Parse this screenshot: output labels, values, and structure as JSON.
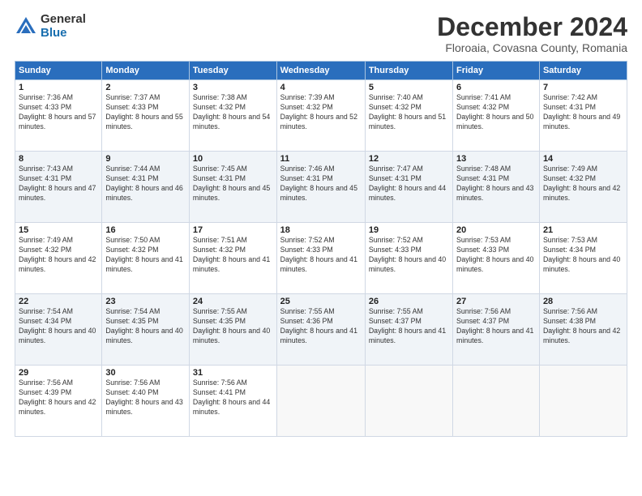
{
  "header": {
    "logo_general": "General",
    "logo_blue": "Blue",
    "month_title": "December 2024",
    "location": "Floroaia, Covasna County, Romania"
  },
  "days_of_week": [
    "Sunday",
    "Monday",
    "Tuesday",
    "Wednesday",
    "Thursday",
    "Friday",
    "Saturday"
  ],
  "weeks": [
    [
      {
        "day": "1",
        "sunrise": "Sunrise: 7:36 AM",
        "sunset": "Sunset: 4:33 PM",
        "daylight": "Daylight: 8 hours and 57 minutes."
      },
      {
        "day": "2",
        "sunrise": "Sunrise: 7:37 AM",
        "sunset": "Sunset: 4:33 PM",
        "daylight": "Daylight: 8 hours and 55 minutes."
      },
      {
        "day": "3",
        "sunrise": "Sunrise: 7:38 AM",
        "sunset": "Sunset: 4:32 PM",
        "daylight": "Daylight: 8 hours and 54 minutes."
      },
      {
        "day": "4",
        "sunrise": "Sunrise: 7:39 AM",
        "sunset": "Sunset: 4:32 PM",
        "daylight": "Daylight: 8 hours and 52 minutes."
      },
      {
        "day": "5",
        "sunrise": "Sunrise: 7:40 AM",
        "sunset": "Sunset: 4:32 PM",
        "daylight": "Daylight: 8 hours and 51 minutes."
      },
      {
        "day": "6",
        "sunrise": "Sunrise: 7:41 AM",
        "sunset": "Sunset: 4:32 PM",
        "daylight": "Daylight: 8 hours and 50 minutes."
      },
      {
        "day": "7",
        "sunrise": "Sunrise: 7:42 AM",
        "sunset": "Sunset: 4:31 PM",
        "daylight": "Daylight: 8 hours and 49 minutes."
      }
    ],
    [
      {
        "day": "8",
        "sunrise": "Sunrise: 7:43 AM",
        "sunset": "Sunset: 4:31 PM",
        "daylight": "Daylight: 8 hours and 47 minutes."
      },
      {
        "day": "9",
        "sunrise": "Sunrise: 7:44 AM",
        "sunset": "Sunset: 4:31 PM",
        "daylight": "Daylight: 8 hours and 46 minutes."
      },
      {
        "day": "10",
        "sunrise": "Sunrise: 7:45 AM",
        "sunset": "Sunset: 4:31 PM",
        "daylight": "Daylight: 8 hours and 45 minutes."
      },
      {
        "day": "11",
        "sunrise": "Sunrise: 7:46 AM",
        "sunset": "Sunset: 4:31 PM",
        "daylight": "Daylight: 8 hours and 45 minutes."
      },
      {
        "day": "12",
        "sunrise": "Sunrise: 7:47 AM",
        "sunset": "Sunset: 4:31 PM",
        "daylight": "Daylight: 8 hours and 44 minutes."
      },
      {
        "day": "13",
        "sunrise": "Sunrise: 7:48 AM",
        "sunset": "Sunset: 4:31 PM",
        "daylight": "Daylight: 8 hours and 43 minutes."
      },
      {
        "day": "14",
        "sunrise": "Sunrise: 7:49 AM",
        "sunset": "Sunset: 4:32 PM",
        "daylight": "Daylight: 8 hours and 42 minutes."
      }
    ],
    [
      {
        "day": "15",
        "sunrise": "Sunrise: 7:49 AM",
        "sunset": "Sunset: 4:32 PM",
        "daylight": "Daylight: 8 hours and 42 minutes."
      },
      {
        "day": "16",
        "sunrise": "Sunrise: 7:50 AM",
        "sunset": "Sunset: 4:32 PM",
        "daylight": "Daylight: 8 hours and 41 minutes."
      },
      {
        "day": "17",
        "sunrise": "Sunrise: 7:51 AM",
        "sunset": "Sunset: 4:32 PM",
        "daylight": "Daylight: 8 hours and 41 minutes."
      },
      {
        "day": "18",
        "sunrise": "Sunrise: 7:52 AM",
        "sunset": "Sunset: 4:33 PM",
        "daylight": "Daylight: 8 hours and 41 minutes."
      },
      {
        "day": "19",
        "sunrise": "Sunrise: 7:52 AM",
        "sunset": "Sunset: 4:33 PM",
        "daylight": "Daylight: 8 hours and 40 minutes."
      },
      {
        "day": "20",
        "sunrise": "Sunrise: 7:53 AM",
        "sunset": "Sunset: 4:33 PM",
        "daylight": "Daylight: 8 hours and 40 minutes."
      },
      {
        "day": "21",
        "sunrise": "Sunrise: 7:53 AM",
        "sunset": "Sunset: 4:34 PM",
        "daylight": "Daylight: 8 hours and 40 minutes."
      }
    ],
    [
      {
        "day": "22",
        "sunrise": "Sunrise: 7:54 AM",
        "sunset": "Sunset: 4:34 PM",
        "daylight": "Daylight: 8 hours and 40 minutes."
      },
      {
        "day": "23",
        "sunrise": "Sunrise: 7:54 AM",
        "sunset": "Sunset: 4:35 PM",
        "daylight": "Daylight: 8 hours and 40 minutes."
      },
      {
        "day": "24",
        "sunrise": "Sunrise: 7:55 AM",
        "sunset": "Sunset: 4:35 PM",
        "daylight": "Daylight: 8 hours and 40 minutes."
      },
      {
        "day": "25",
        "sunrise": "Sunrise: 7:55 AM",
        "sunset": "Sunset: 4:36 PM",
        "daylight": "Daylight: 8 hours and 41 minutes."
      },
      {
        "day": "26",
        "sunrise": "Sunrise: 7:55 AM",
        "sunset": "Sunset: 4:37 PM",
        "daylight": "Daylight: 8 hours and 41 minutes."
      },
      {
        "day": "27",
        "sunrise": "Sunrise: 7:56 AM",
        "sunset": "Sunset: 4:37 PM",
        "daylight": "Daylight: 8 hours and 41 minutes."
      },
      {
        "day": "28",
        "sunrise": "Sunrise: 7:56 AM",
        "sunset": "Sunset: 4:38 PM",
        "daylight": "Daylight: 8 hours and 42 minutes."
      }
    ],
    [
      {
        "day": "29",
        "sunrise": "Sunrise: 7:56 AM",
        "sunset": "Sunset: 4:39 PM",
        "daylight": "Daylight: 8 hours and 42 minutes."
      },
      {
        "day": "30",
        "sunrise": "Sunrise: 7:56 AM",
        "sunset": "Sunset: 4:40 PM",
        "daylight": "Daylight: 8 hours and 43 minutes."
      },
      {
        "day": "31",
        "sunrise": "Sunrise: 7:56 AM",
        "sunset": "Sunset: 4:41 PM",
        "daylight": "Daylight: 8 hours and 44 minutes."
      },
      null,
      null,
      null,
      null
    ]
  ]
}
